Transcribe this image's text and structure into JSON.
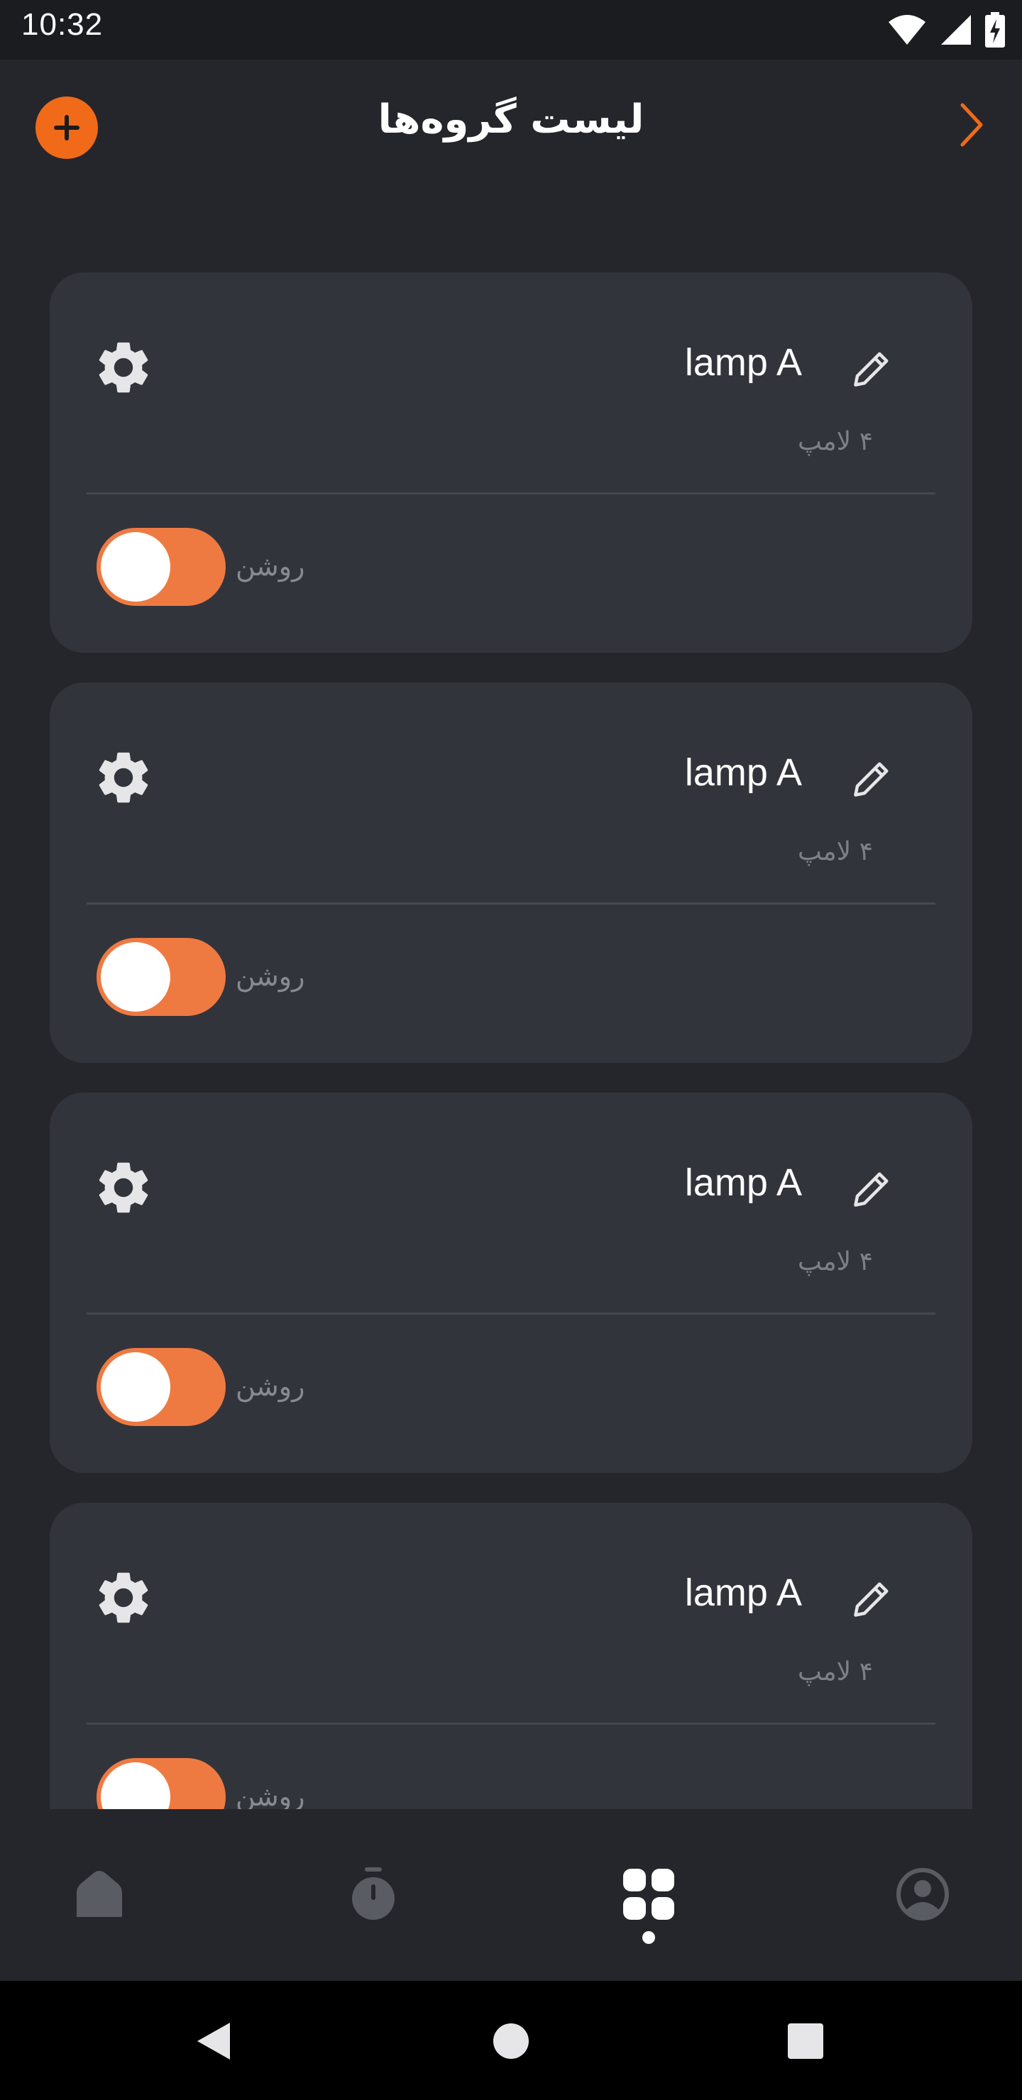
{
  "status_bar": {
    "time": "10:32"
  },
  "header": {
    "title": "لیست گروه‌ها"
  },
  "groups": [
    {
      "name": "lamp A",
      "count": "۴ لامپ",
      "state": "روشن",
      "on": true
    },
    {
      "name": "lamp A",
      "count": "۴ لامپ",
      "state": "روشن",
      "on": true
    },
    {
      "name": "lamp A",
      "count": "۴ لامپ",
      "state": "روشن",
      "on": true
    },
    {
      "name": "lamp A",
      "count": "۴ لامپ",
      "state": "روشن",
      "on": true
    }
  ],
  "bottom_nav": {
    "items": [
      "home-icon",
      "timer-icon",
      "groups-icon",
      "profile-icon"
    ],
    "active": "groups-icon"
  },
  "colors": {
    "accent": "#f06a19",
    "toggle_on": "#ee7a42",
    "card": "#32343b",
    "background": "#25262b"
  }
}
